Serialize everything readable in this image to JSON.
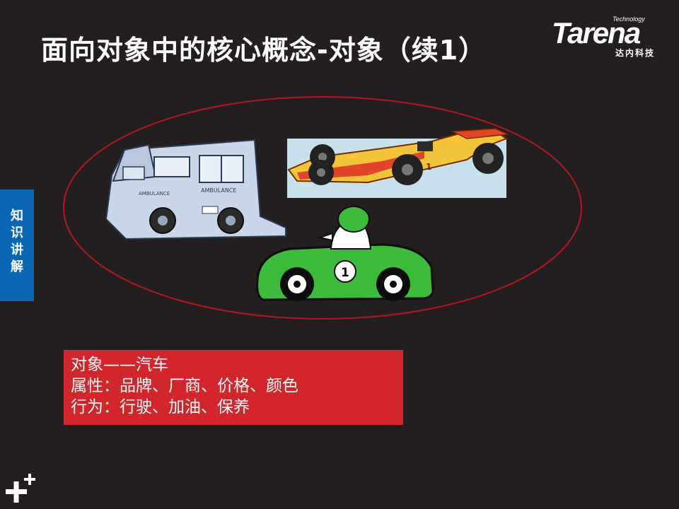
{
  "slide": {
    "title": "面向对象中的核心概念-对象（续1）"
  },
  "logo": {
    "tagline": "Technology",
    "name": "Tarena",
    "subtitle": "达内科技"
  },
  "side_tab": {
    "label": "知识讲解"
  },
  "info_box": {
    "lines": [
      "对象——汽车",
      "属性：品牌、厂商、价格、颜色",
      "行为：行驶、加油、保养"
    ]
  },
  "illustration": {
    "ambulance_text": "AMBULANCE",
    "race_car_number": "1",
    "green_car_number": "1"
  },
  "colors": {
    "background": "#231f20",
    "accent_blue": "#0a67b4",
    "accent_red": "#d3262c",
    "ellipse": "#b3161c",
    "green_car": "#3dbb3a"
  }
}
